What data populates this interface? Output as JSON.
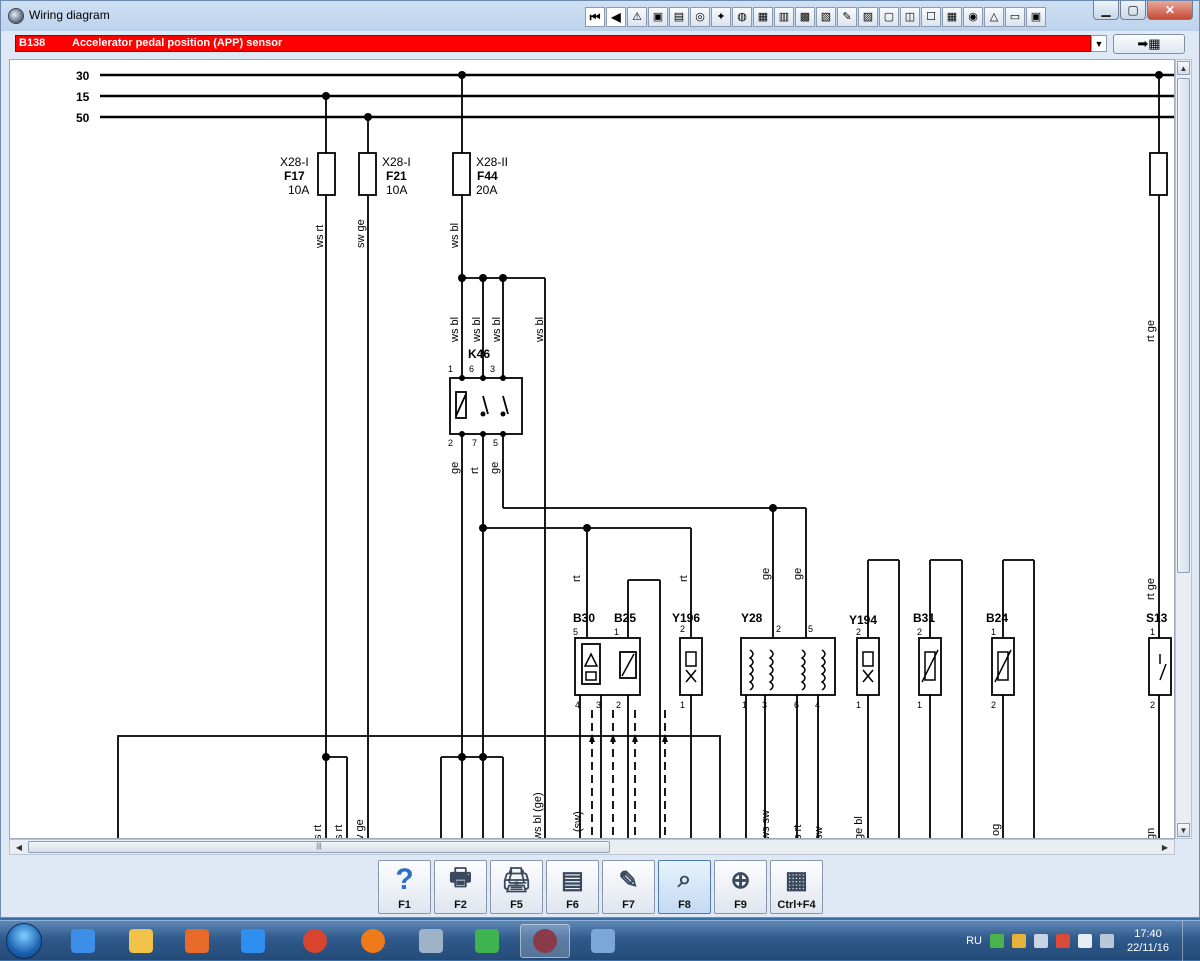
{
  "window": {
    "title": "Wiring diagram"
  },
  "toolbar": {
    "buttons": [
      {
        "name": "first-icon",
        "glyph": "⏮"
      },
      {
        "name": "back-icon",
        "glyph": "◀"
      },
      {
        "name": "warning-icon",
        "glyph": "⚠"
      },
      {
        "name": "info-icon",
        "glyph": "▣"
      },
      {
        "name": "tool-1-icon",
        "glyph": "▤"
      },
      {
        "name": "tool-2-icon",
        "glyph": "◎"
      },
      {
        "name": "tool-3-icon",
        "glyph": "✦"
      },
      {
        "name": "tool-4-icon",
        "glyph": "◍"
      },
      {
        "name": "tool-5-icon",
        "glyph": "▦"
      },
      {
        "name": "tool-6-icon",
        "glyph": "▥"
      },
      {
        "name": "tool-7-icon",
        "glyph": "▩"
      },
      {
        "name": "tool-8-icon",
        "glyph": "▧"
      },
      {
        "name": "tool-9-icon",
        "glyph": "✎"
      },
      {
        "name": "tool-10-icon",
        "glyph": "▨"
      },
      {
        "name": "tool-11-icon",
        "glyph": "▢"
      },
      {
        "name": "tool-12-icon",
        "glyph": "◫"
      },
      {
        "name": "tool-13-icon",
        "glyph": "☐"
      },
      {
        "name": "tool-14-icon",
        "glyph": "▦"
      },
      {
        "name": "tool-15-icon",
        "glyph": "◉"
      },
      {
        "name": "tool-16-icon",
        "glyph": "△"
      },
      {
        "name": "tool-17-icon",
        "glyph": "▭"
      },
      {
        "name": "tool-18-icon",
        "glyph": "▣"
      }
    ]
  },
  "component_bar": {
    "code": "B138",
    "name": "Accelerator pedal position (APP) sensor"
  },
  "diagram": {
    "bus_labels": [
      "30",
      "15",
      "50"
    ],
    "fuses": [
      {
        "conn": "X28-I",
        "name": "F17",
        "rating": "10A"
      },
      {
        "conn": "X28-I",
        "name": "F21",
        "rating": "10A"
      },
      {
        "conn": "X28-II",
        "name": "F44",
        "rating": "20A"
      }
    ],
    "wires": {
      "ws_rt": "ws rt",
      "sw_ge": "sw ge",
      "ws_bl": "ws bl",
      "rt_ge": "rt ge",
      "ge": "ge",
      "rt": "rt",
      "ws_bl_ge": "ws bl (ge)",
      "sw_paren": "(sw)",
      "ge_bl": "ge bl",
      "og": "og",
      "gn": "gn",
      "sw": "sw",
      "ws_sw": "ws sw",
      "ge_sw": "ge sw",
      "s_rt": "s rt",
      "v_ge": "v ge"
    },
    "relay": {
      "name": "K46",
      "pins_top": [
        "1",
        "6",
        "3"
      ],
      "pins_bottom": [
        "2",
        "7",
        "5"
      ]
    },
    "components": [
      {
        "name": "B30",
        "pins_top": [
          "5"
        ],
        "pins_bottom": [
          "4",
          "3"
        ]
      },
      {
        "name": "B25",
        "pins_top": [
          "1"
        ],
        "pins_bottom": [
          "2"
        ]
      },
      {
        "name": "Y196",
        "pins_top": [
          "2"
        ],
        "pins_bottom": [
          "1"
        ]
      },
      {
        "name": "Y28",
        "pins_top": [
          "2",
          "5"
        ],
        "pins_bottom": [
          "1",
          "3",
          "6",
          "4"
        ]
      },
      {
        "name": "Y194",
        "pins_top": [
          "2"
        ],
        "pins_bottom": [
          "1"
        ]
      },
      {
        "name": "B31",
        "pins_top": [
          "2"
        ],
        "pins_bottom": [
          "1"
        ]
      },
      {
        "name": "B24",
        "pins_top": [
          "1"
        ],
        "pins_bottom": [
          "2"
        ]
      },
      {
        "name": "S13",
        "pins_top": [
          "1"
        ],
        "pins_bottom": [
          "2"
        ]
      }
    ]
  },
  "function_keys": [
    {
      "key": "F1",
      "icon": "help-icon",
      "glyph": "?"
    },
    {
      "key": "F2",
      "icon": "print-preview-icon",
      "glyph": "🖶"
    },
    {
      "key": "F5",
      "icon": "printer-icon",
      "glyph": "🖨"
    },
    {
      "key": "F6",
      "icon": "component-list-icon",
      "glyph": "▤"
    },
    {
      "key": "F7",
      "icon": "pen-icon",
      "glyph": "✎"
    },
    {
      "key": "F8",
      "icon": "zoom-area-icon",
      "glyph": "⌕",
      "active": true
    },
    {
      "key": "F9",
      "icon": "magnifier-icon",
      "glyph": "⊕"
    },
    {
      "key": "Ctrl+F4",
      "icon": "table-icon",
      "glyph": "▦"
    }
  ],
  "taskbar": {
    "apps": [
      {
        "name": "ie-icon",
        "color": "#3c8ee8"
      },
      {
        "name": "explorer-icon",
        "color": "#f2c24b"
      },
      {
        "name": "media-player-icon",
        "color": "#e86a2a"
      },
      {
        "name": "play-icon",
        "color": "#2f8ff0"
      },
      {
        "name": "chrome-icon",
        "color": "#d9442f"
      },
      {
        "name": "firefox-icon",
        "color": "#ef7a1a"
      },
      {
        "name": "calculator-icon",
        "color": "#9fb3c8"
      },
      {
        "name": "clover-icon",
        "color": "#3fb34f"
      },
      {
        "name": "wiring-app-icon",
        "color": "#8a3b4a",
        "open": true
      },
      {
        "name": "paint-icon",
        "color": "#7aa6d8"
      }
    ],
    "lang": "RU",
    "time": "17:40",
    "date": "22/11/16"
  },
  "colors": {
    "accent_red": "#ff0000",
    "wire": "#000000",
    "window_bg": "#dfe9f5"
  }
}
